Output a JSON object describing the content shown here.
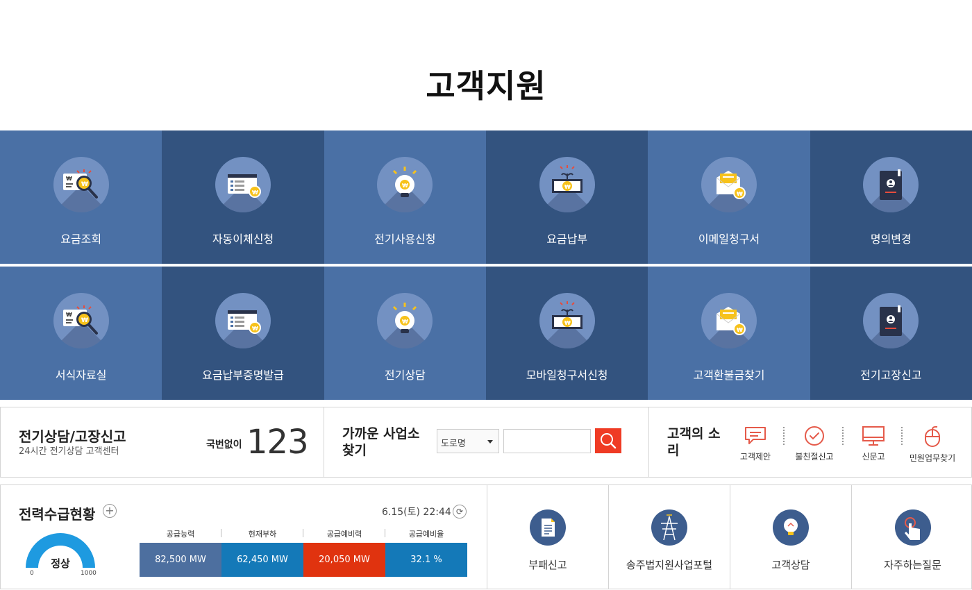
{
  "page_title": "고객지원",
  "tiles_row1": [
    {
      "label": "요금조회",
      "icon": "bill-search-icon"
    },
    {
      "label": "자동이체신청",
      "icon": "card-form-icon"
    },
    {
      "label": "전기사용신청",
      "icon": "lightbulb-icon"
    },
    {
      "label": "요금납부",
      "icon": "money-plant-icon"
    },
    {
      "label": "이메일청구서",
      "icon": "email-bill-icon"
    },
    {
      "label": "명의변경",
      "icon": "passport-icon"
    }
  ],
  "tiles_row2": [
    {
      "label": "서식자료실",
      "icon": "bill-search-icon"
    },
    {
      "label": "요금납부증명발급",
      "icon": "card-form-icon"
    },
    {
      "label": "전기상담",
      "icon": "lightbulb-icon"
    },
    {
      "label": "모바일청구서신청",
      "icon": "money-plant-icon"
    },
    {
      "label": "고객환불금찾기",
      "icon": "email-bill-icon"
    },
    {
      "label": "전기고장신고",
      "icon": "passport-icon"
    }
  ],
  "hotline": {
    "title": "전기상담/고장신고",
    "subtitle": "24시간 전기상담 고객센터",
    "prefix": "국번없이",
    "number": "123"
  },
  "office_finder": {
    "title": "가까운 사업소 찾기",
    "select_value": "도로명",
    "input_placeholder": ""
  },
  "customer_voice": {
    "title": "고객의 소리",
    "items": [
      {
        "label": "고객제안",
        "icon": "speech-bubble-icon"
      },
      {
        "label": "불친절신고",
        "icon": "check-circle-icon"
      },
      {
        "label": "신문고",
        "icon": "monitor-icon"
      },
      {
        "label": "민원업무찾기",
        "icon": "mouse-icon"
      }
    ]
  },
  "power_status": {
    "title": "전력수급현황",
    "timestamp": "6.15(토) 22:44",
    "gauge_status": "정상",
    "gauge_min": "0",
    "gauge_max": "1000",
    "kpis": [
      {
        "label": "공급능력",
        "value": "82,500 MW",
        "color": "#4d6f9f"
      },
      {
        "label": "현재부하",
        "value": "62,450 MW",
        "color": "#1479b8"
      },
      {
        "label": "공급예비력",
        "value": "20,050 MW",
        "color": "#e0330f"
      },
      {
        "label": "공급예비율",
        "value": "32.1 %",
        "color": "#1479b8"
      }
    ]
  },
  "services": [
    {
      "label": "부패신고",
      "icon": "document-icon"
    },
    {
      "label": "송주법지원사업포털",
      "icon": "power-tower-icon"
    },
    {
      "label": "고객상담",
      "icon": "lightbulb-icon"
    },
    {
      "label": "자주하는질문",
      "icon": "hand-pointer-icon"
    }
  ],
  "colors": {
    "tile_light": "#4a70a5",
    "tile_dark": "#33537f",
    "accent_red": "#ef3b24",
    "gauge_blue": "#1e9ae0"
  }
}
